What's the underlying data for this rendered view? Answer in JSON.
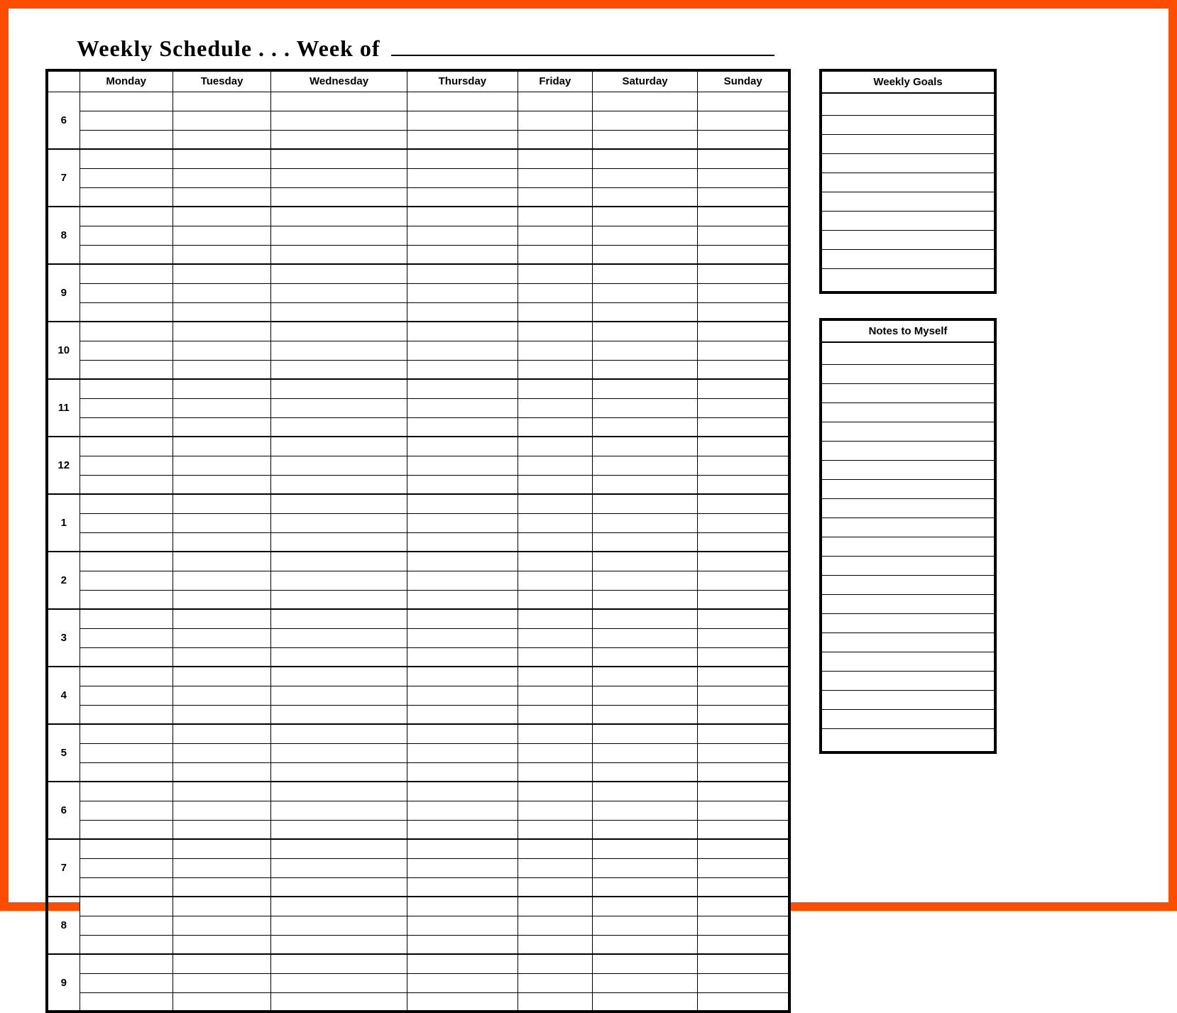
{
  "title": {
    "prefix": "Weekly Schedule . . . Week of",
    "value": ""
  },
  "schedule": {
    "timeHeader": "",
    "days": [
      "Monday",
      "Tuesday",
      "Wednesday",
      "Thursday",
      "Friday",
      "Saturday",
      "Sunday"
    ],
    "hours": [
      "6",
      "7",
      "8",
      "9",
      "10",
      "11",
      "12",
      "1",
      "2",
      "3",
      "4",
      "5",
      "6",
      "7",
      "8",
      "9"
    ],
    "rowsPerHour": 3
  },
  "sidebar": {
    "goals": {
      "title": "Weekly Goals",
      "lineCount": 10
    },
    "notes": {
      "title": "Notes to Myself",
      "lineCount": 21
    }
  }
}
